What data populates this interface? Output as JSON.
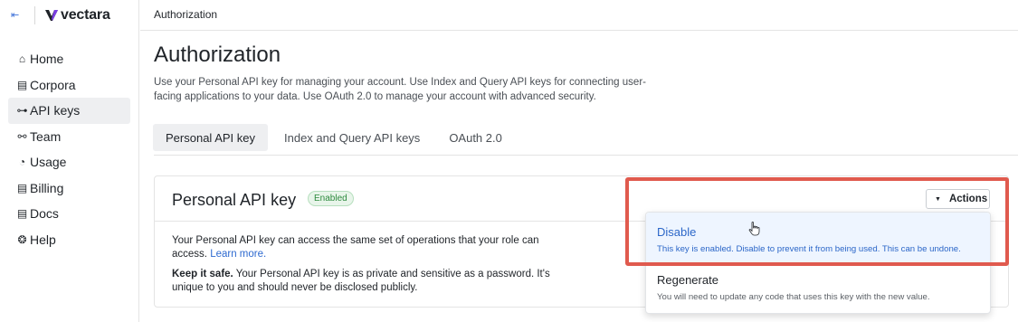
{
  "app": {
    "name": "vectara",
    "accent": "#2e6ad0",
    "logo_colors": [
      "#1f2328",
      "#7b3fe4"
    ]
  },
  "sidebar": {
    "collapse_icon": "collapse-left-icon",
    "items": [
      {
        "label": "Home",
        "icon": "home-icon",
        "active": false
      },
      {
        "label": "Corpora",
        "icon": "corpora-icon",
        "active": false
      },
      {
        "label": "API keys",
        "icon": "key-icon",
        "active": true
      },
      {
        "label": "Team",
        "icon": "team-icon",
        "active": false
      },
      {
        "label": "Usage",
        "icon": "usage-icon",
        "active": false
      },
      {
        "label": "Billing",
        "icon": "billing-icon",
        "active": false
      },
      {
        "label": "Docs",
        "icon": "docs-icon",
        "active": false
      },
      {
        "label": "Help",
        "icon": "help-icon",
        "active": false
      }
    ]
  },
  "header": {
    "breadcrumb": "Authorization"
  },
  "main": {
    "title": "Authorization",
    "intro": "Use your Personal API key for managing your account. Use Index and Query API keys for connecting user-facing applications to your data. Use OAuth 2.0 to manage your account with advanced security.",
    "tabs": [
      {
        "label": "Personal API key",
        "active": true
      },
      {
        "label": "Index and Query API keys",
        "active": false
      },
      {
        "label": "OAuth 2.0",
        "active": false
      }
    ],
    "card": {
      "title": "Personal API key",
      "badge": "Enabled",
      "p1": "Your Personal API key can access the same set of operations that your role can access.",
      "p1_link": "Learn more.",
      "p2_bold": "Keep it safe.",
      "p2": "Your Personal API key is as private and sensitive as a password. It's unique to you and should never be disclosed publicly."
    },
    "actions_button": "Actions",
    "menu": [
      {
        "label": "Disable",
        "description": "This key is enabled. Disable to prevent it from being used. This can be undone.",
        "highlighted": true
      },
      {
        "label": "Regenerate",
        "description": "You will need to update any code that uses this key with the new value.",
        "highlighted": false
      }
    ]
  },
  "colors": {
    "highlight_box": "#e05a4e",
    "enabled_badge": "#2d8a3e"
  }
}
